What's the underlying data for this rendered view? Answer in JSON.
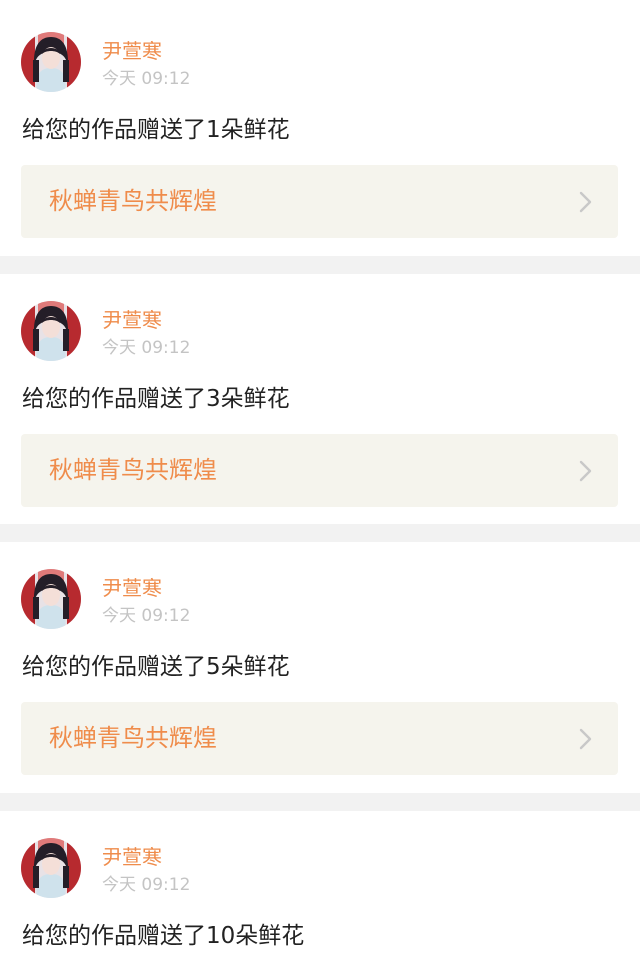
{
  "feed": {
    "items": [
      {
        "user": "尹萱寒",
        "time": "今天 09:12",
        "message": "给您的作品赠送了1朵鲜花",
        "work_title": "秋蝉青鸟共辉煌"
      },
      {
        "user": "尹萱寒",
        "time": "今天 09:12",
        "message": "给您的作品赠送了3朵鲜花",
        "work_title": "秋蝉青鸟共辉煌"
      },
      {
        "user": "尹萱寒",
        "time": "今天 09:12",
        "message": "给您的作品赠送了5朵鲜花",
        "work_title": "秋蝉青鸟共辉煌"
      },
      {
        "user": "尹萱寒",
        "time": "今天 09:12",
        "message": "给您的作品赠送了10朵鲜花",
        "work_title": ""
      }
    ]
  },
  "icons": {
    "avatar": "avatar-portrait",
    "chevron": "chevron-right-icon"
  },
  "colors": {
    "accent": "#ef8c4b",
    "card_background": "#ffffff",
    "page_background": "#f2f2f2",
    "link_background": "#f5f4ed",
    "timestamp": "#c4c4c4",
    "message_text": "#222222",
    "chevron": "#c8c8c8"
  }
}
